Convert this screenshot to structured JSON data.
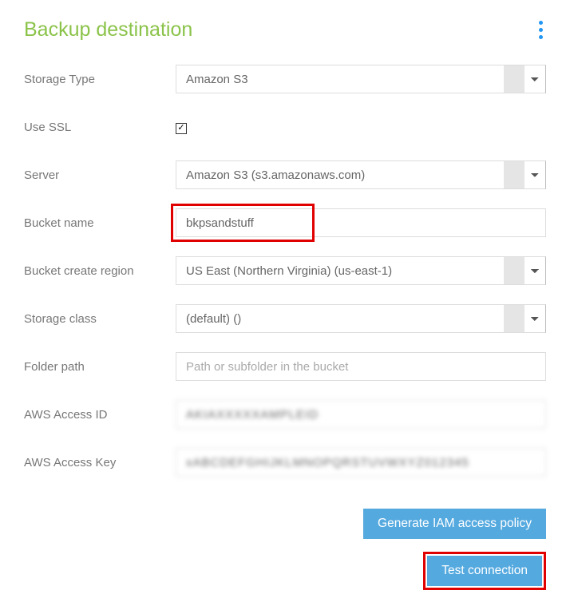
{
  "header": {
    "title": "Backup destination"
  },
  "fields": {
    "storage_type": {
      "label": "Storage Type",
      "value": "Amazon S3"
    },
    "use_ssl": {
      "label": "Use SSL",
      "checked": true
    },
    "server": {
      "label": "Server",
      "value": "Amazon S3 (s3.amazonaws.com)"
    },
    "bucket_name": {
      "label": "Bucket name",
      "value": "bkpsandstuff"
    },
    "bucket_region": {
      "label": "Bucket create region",
      "value": "US East (Northern Virginia) (us-east-1)"
    },
    "storage_class": {
      "label": "Storage class",
      "value": "(default) ()"
    },
    "folder_path": {
      "label": "Folder path",
      "placeholder": "Path or subfolder in the bucket",
      "value": ""
    },
    "access_id": {
      "label": "AWS Access ID",
      "value_masked": "AKIAXXXXXAMPLEID"
    },
    "access_key": {
      "label": "AWS Access Key",
      "value_masked": "xABCDEFGHIJKLMNOPQRSTUVWXYZ012345"
    }
  },
  "actions": {
    "generate_policy": "Generate IAM access policy",
    "test_connection": "Test connection"
  }
}
